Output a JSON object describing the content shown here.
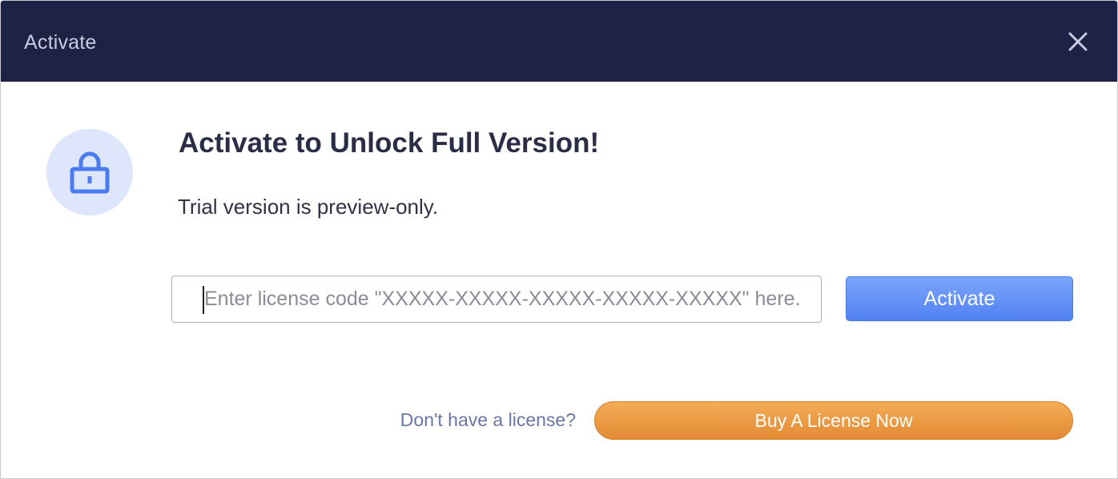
{
  "window": {
    "title": "Activate",
    "close_icon": "close-icon"
  },
  "content": {
    "icon": "lock-icon",
    "headline": "Activate to Unlock Full Version!",
    "subtext": "Trial version is preview-only."
  },
  "license_form": {
    "input_value": "",
    "input_placeholder": "Enter license code \"XXXXX-XXXXX-XXXXX-XXXXX-XXXXX\" here.",
    "activate_label": "Activate"
  },
  "purchase": {
    "prompt": "Don't have a license?",
    "buy_label": "Buy A License Now"
  },
  "colors": {
    "titlebar": "#1e2245",
    "accent_blue": "#5b8cf5",
    "accent_orange": "#eb9a45",
    "icon_bg": "#dde6fb"
  }
}
